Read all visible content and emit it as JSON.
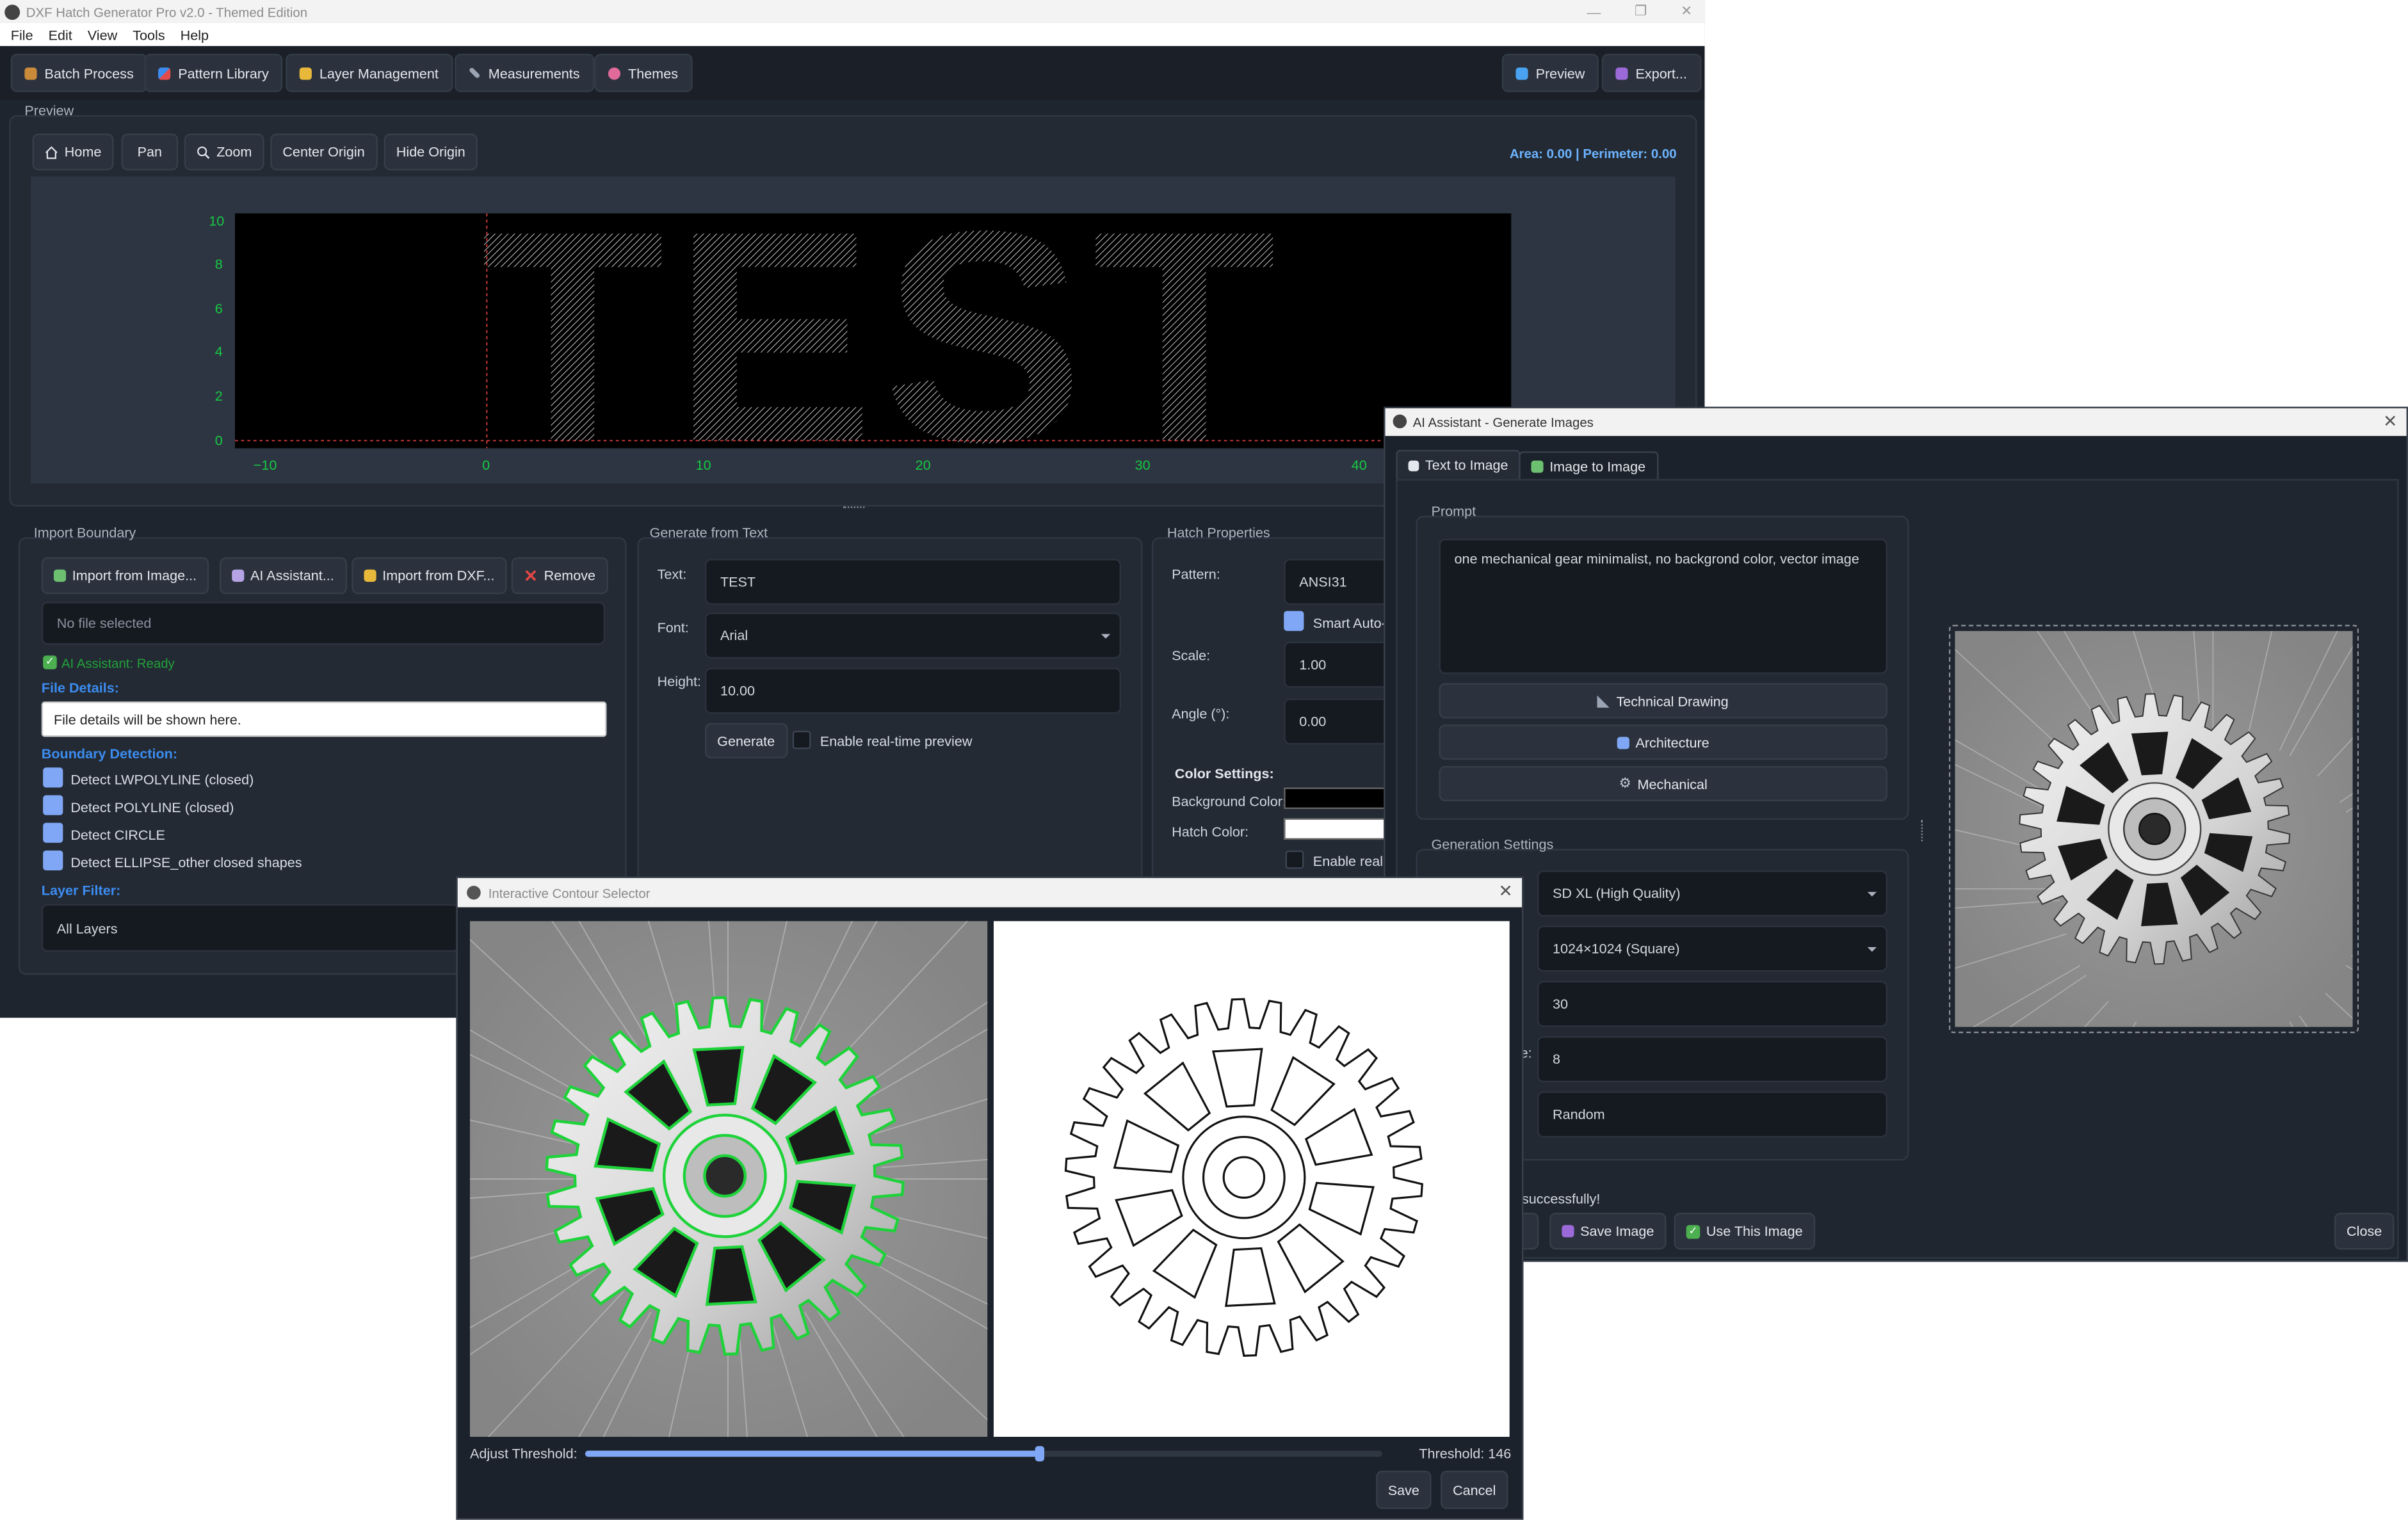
{
  "main_window": {
    "title": "DXF Hatch Generator Pro v2.0 - Themed Edition",
    "menu": [
      "File",
      "Edit",
      "View",
      "Tools",
      "Help"
    ],
    "toolbar": {
      "batch": "Batch Process",
      "pattern_library": "Pattern Library",
      "layer_management": "Layer Management",
      "measurements": "Measurements",
      "themes": "Themes",
      "preview": "Preview",
      "export": "Export..."
    },
    "preview": {
      "label": "Preview",
      "home": "Home",
      "pan": "Pan",
      "zoom": "Zoom",
      "center_origin": "Center Origin",
      "hide_origin": "Hide Origin",
      "status": "Area: 0.00 | Perimeter: 0.00",
      "text_rendered": "TEST",
      "y_ticks": [
        "10",
        "8",
        "6",
        "4",
        "2",
        "0"
      ],
      "x_ticks": [
        "−10",
        "0",
        "10",
        "20",
        "30",
        "40"
      ]
    },
    "import_boundary": {
      "label": "Import Boundary",
      "import_image": "Import from Image...",
      "ai_assistant": "AI Assistant...",
      "import_dxf": "Import from DXF...",
      "remove": "Remove",
      "file_field": "No file selected",
      "ai_status": "AI Assistant: Ready",
      "file_details_label": "File Details:",
      "file_details_value": "File details will be shown here.",
      "boundary_detection_label": "Boundary Detection:",
      "detect_items": [
        "Detect LWPOLYLINE (closed)",
        "Detect POLYLINE (closed)",
        "Detect CIRCLE",
        "Detect ELLIPSE_other closed shapes"
      ],
      "layer_filter_label": "Layer Filter:",
      "layer_filter_value": "All Layers"
    },
    "generate_text": {
      "label": "Generate from Text",
      "text_label": "Text:",
      "text_value": "TEST",
      "font_label": "Font:",
      "font_value": "Arial",
      "height_label": "Height:",
      "height_value": "10.00",
      "generate_button": "Generate",
      "realtime_label": "Enable real-time preview"
    },
    "hatch_properties": {
      "label": "Hatch Properties",
      "pattern_label": "Pattern:",
      "pattern_value": "ANSI31",
      "smart_auto": "Smart Auto-",
      "scale_label": "Scale:",
      "scale_value": "1.00",
      "angle_label": "Angle (°):",
      "angle_value": "0.00",
      "color_settings": "Color Settings:",
      "background_color_label": "Background Color:",
      "hatch_color_label": "Hatch Color:",
      "enable_realtime": "Enable real-"
    }
  },
  "ai_window": {
    "title": "AI Assistant - Generate Images",
    "tabs": [
      "Text to Image",
      "Image to Image"
    ],
    "prompt_label": "Prompt",
    "prompt_value": "one mechanical gear minimalist, no backgrond color, vector image",
    "presets": [
      "Technical Drawing",
      "Architecture",
      "Mechanical"
    ],
    "generation_settings_label": "Generation Settings",
    "model_value": "SD XL (High Quality)",
    "size_value": "1024×1024 (Square)",
    "steps_value": "30",
    "guidance_partial_label": "e:",
    "guidance_value": "8",
    "seed_value": "Random",
    "status_text": "successfully!",
    "partial_button": "e",
    "save_image": "Save Image",
    "use_image": "Use This Image",
    "close": "Close"
  },
  "contour_window": {
    "title": "Interactive Contour Selector",
    "adjust_threshold_label": "Adjust Threshold:",
    "threshold_value_label": "Threshold: 146",
    "threshold_fraction": 0.57,
    "save": "Save",
    "cancel": "Cancel"
  },
  "colors": {
    "accent_green": "#16c943",
    "accent_blue": "#3c8cf0",
    "checkbox_blue": "#7fa7f5",
    "ai_ready_green": "#22a33a"
  }
}
